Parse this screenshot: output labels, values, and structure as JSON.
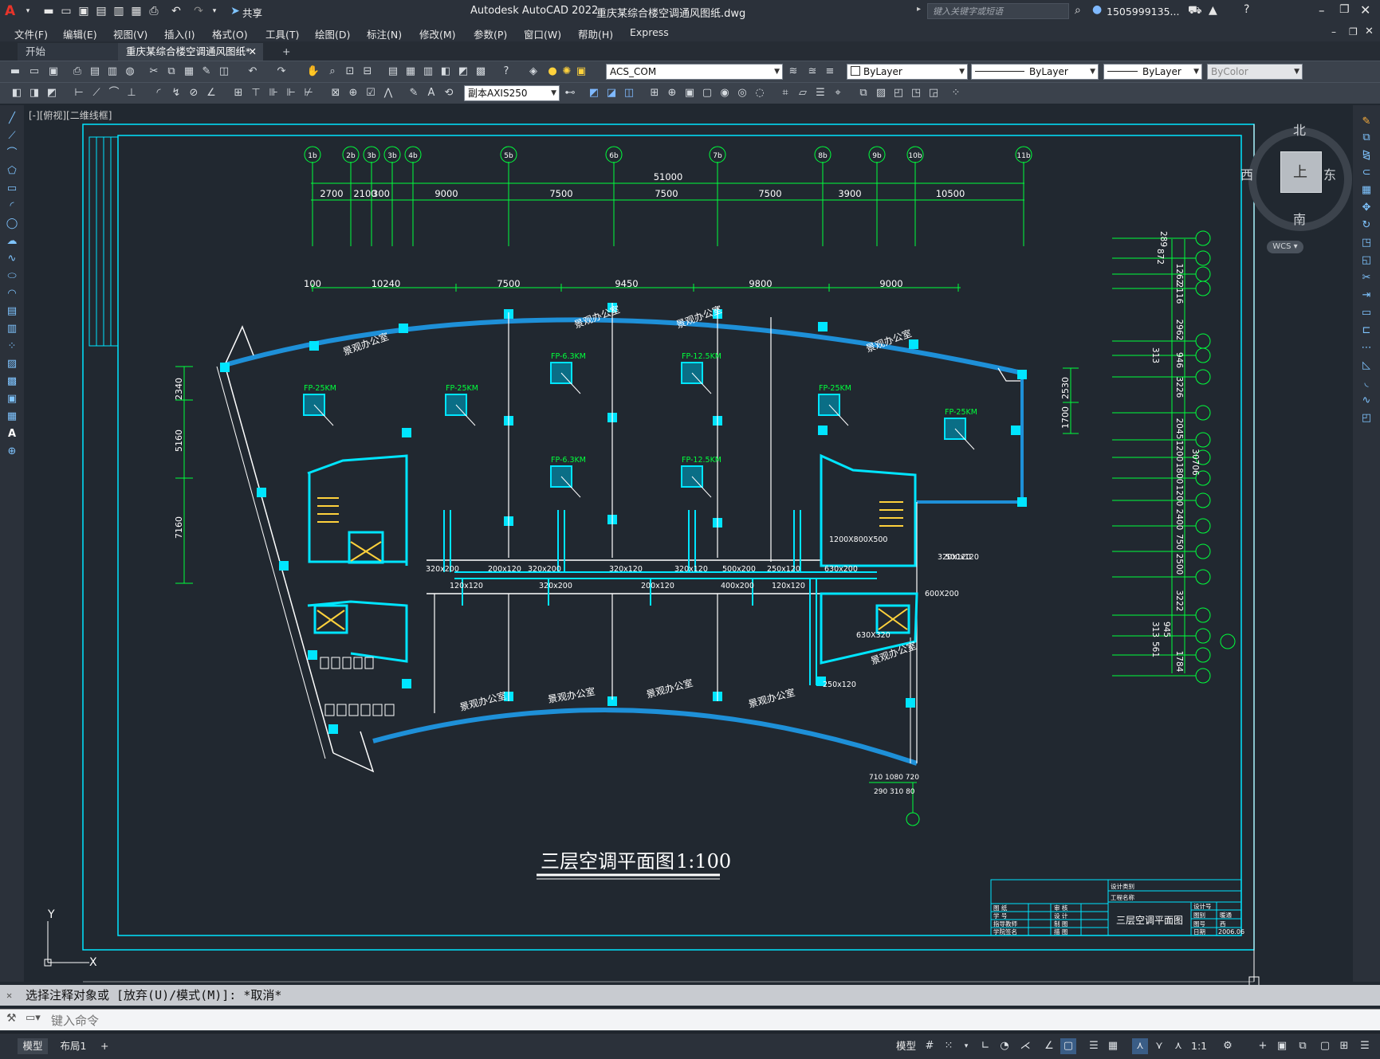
{
  "title_bar": {
    "app_title": "Autodesk AutoCAD 2022",
    "doc_title": "重庆某综合楼空调通风图纸.dwg",
    "share_label": "共享",
    "search_placeholder": "键入关键字或短语",
    "user": "1505999135...",
    "window_controls": [
      "minimize-icon",
      "restore-icon",
      "close-icon"
    ]
  },
  "menu": {
    "items": [
      "文件(F)",
      "编辑(E)",
      "视图(V)",
      "插入(I)",
      "格式(O)",
      "工具(T)",
      "绘图(D)",
      "标注(N)",
      "修改(M)",
      "参数(P)",
      "窗口(W)",
      "帮助(H)",
      "Express"
    ]
  },
  "tabs": {
    "start": "开始",
    "active": "重庆某综合楼空调通风图纸*",
    "add": "+"
  },
  "properties": {
    "layer": "ACS_COM",
    "color": "ByLayer",
    "linetype": "ByLayer",
    "lineweight": "ByLayer",
    "plotstyle": "ByColor",
    "dimstyle": "副本AXIS250"
  },
  "viewport": {
    "label": "[-][俯视][二维线框]",
    "compass": {
      "north": "北",
      "south": "南",
      "east": "东",
      "west": "西",
      "top": "上"
    },
    "wcs": "WCS",
    "ucs_x": "X",
    "ucs_y": "Y"
  },
  "drawing": {
    "top_axes": [
      "1b",
      "2b",
      "3b",
      "3b",
      "4b",
      "5b",
      "6b",
      "7b",
      "8b",
      "9b",
      "10b",
      "11b"
    ],
    "top_overall": "51000",
    "top_dims": [
      "2700",
      "2100",
      "300",
      "9000",
      "7500",
      "7500",
      "7500",
      "3900",
      "10500"
    ],
    "row2_dims": [
      "100",
      "10240",
      "7500",
      "9450",
      "9800",
      "9000"
    ],
    "left_dims": [
      "2340",
      "5160",
      "7160"
    ],
    "right_dims": [
      "2530",
      "1700"
    ],
    "right_axis_dims": [
      "289",
      "872",
      "1262",
      "2116",
      "2962",
      "946",
      "313",
      "3226",
      "2045",
      "1200",
      "1800",
      "1200",
      "2400",
      "750",
      "2500",
      "3222",
      "945",
      "313",
      "561",
      "1784"
    ],
    "right_total": "30706",
    "fan_coils": [
      "FP-25KM",
      "FP-25KM",
      "FP-6.3KM",
      "FP-12.5KM",
      "FP-25KM",
      "FP-25KM",
      "FP-6.3KM",
      "FP-12.5KM"
    ],
    "rooms": [
      "景观办公室",
      "景观办公室",
      "景观办公室",
      "景观办公室",
      "景观办公室",
      "景观办公室",
      "景观办公室",
      "景观办公室",
      "景观办公室",
      "景观办公室"
    ],
    "ducts": [
      "320x200",
      "200x120",
      "320x200",
      "320x120",
      "120x120",
      "320x200",
      "200x120",
      "400x200",
      "120x120",
      "320x120",
      "500x200",
      "250x120",
      "630x200",
      "1200X800X500",
      "630X320",
      "600X200",
      "250x120",
      "320x120",
      "500x120"
    ],
    "plan_title": "三层空调平面图",
    "scale": "1:100",
    "title_block": {
      "name": "三层空调平面图",
      "date": "2006.06",
      "rows": [
        "图 纸",
        "学 号",
        "指导教师",
        "学院签名",
        "审 核",
        "设 计",
        "制 图",
        "描 图"
      ],
      "right_labels": [
        "设计类别",
        "工程名称"
      ],
      "small": [
        "设计号",
        "图别",
        "图号",
        "日期"
      ],
      "small_vals": [
        "暖通",
        "西"
      ]
    }
  },
  "command": {
    "history": "选择注释对象或 [放弃(U)/模式(M)]: *取消*",
    "placeholder": "键入命令"
  },
  "status": {
    "model_tab": "模型",
    "layout_tab": "布局1",
    "add": "+",
    "model_label": "模型",
    "scale": "1:1"
  },
  "colors": {
    "canvas": "#212830",
    "cyan": "#00e5ff",
    "green": "#00ff3c",
    "white": "#ffffff",
    "blue": "#1e90d8"
  }
}
